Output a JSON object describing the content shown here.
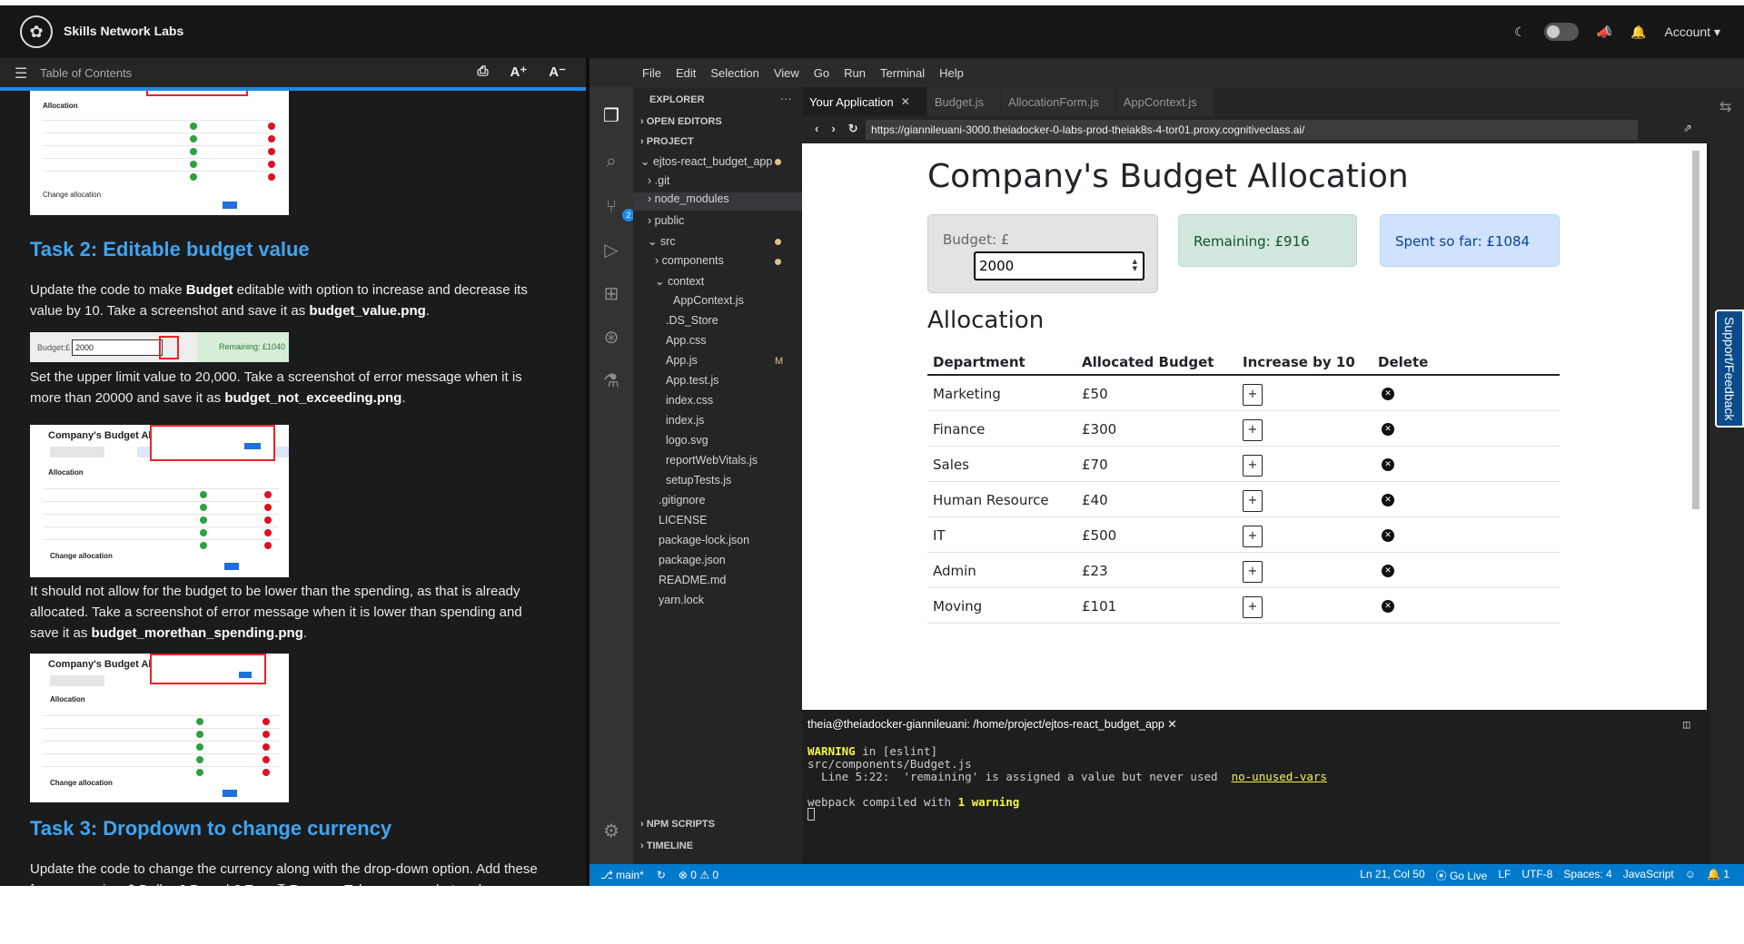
{
  "topbar": {
    "brand": "Skills Network Labs",
    "account": "Account ▾"
  },
  "toc": {
    "label": "Table of Contents",
    "font_up": "A⁺",
    "font_down": "A⁻"
  },
  "left": {
    "task2_title": "Task 2: Editable budget value",
    "task2_p1_a": "Update the code to make ",
    "task2_p1_b": "Budget",
    "task2_p1_c": " editable with option to increase and decrease its value by 10. Take a screenshot and save it as ",
    "task2_p1_d": "budget_value.png",
    "task2_p1_e": ".",
    "strip_budget": "Budget:£",
    "strip_value": "2000",
    "strip_remaining": "Remaining: £1040",
    "task2_p2_a": "Set the upper limit value to 20,000. Take a screenshot of error message when it is more than 20000 and save it as ",
    "task2_p2_b": "budget_not_exceeding.png",
    "task2_p2_c": ".",
    "task2_p3_a": "It should not allow for the budget to be lower than the spending, as that is already allocated. Take a screenshot of error message when it is lower than spending and save it as ",
    "task2_p3_b": "budget_morethan_spending.png",
    "task2_p3_c": ".",
    "thumb_title": "Company's Budget Allo",
    "thumb_alloc": "Allocation",
    "thumb_change": "Change allocation",
    "task3_title": "Task 3: Dropdown to change currency",
    "task3_p1": "Update the code to change the currency along with the drop-down option. Add these four currencies: $ Dollar £ Pound € Euro ₹ Ruppee. Take a screenshot and save"
  },
  "menu": [
    "File",
    "Edit",
    "Selection",
    "View",
    "Go",
    "Run",
    "Terminal",
    "Help"
  ],
  "explorer": {
    "title": "EXPLORER",
    "more": "···",
    "open_editors": "OPEN EDITORS",
    "project": "PROJECT",
    "root": "ejtos-react_budget_app",
    "items": [
      ".git",
      "node_modules",
      "public",
      "src",
      "components",
      "context",
      "AppContext.js",
      ".DS_Store",
      "App.css",
      "App.js",
      "App.test.js",
      "index.css",
      "index.js",
      "logo.svg",
      "reportWebVitals.js",
      "setupTests.js",
      ".gitignore",
      "LICENSE",
      "package-lock.json",
      "package.json",
      "README.md",
      "yarn.lock"
    ],
    "modified_mark": "M",
    "npm_scripts": "NPM SCRIPTS",
    "timeline": "TIMELINE"
  },
  "tabs": [
    "Your Application",
    "Budget.js",
    "AllocationForm.js",
    "AppContext.js"
  ],
  "url": "https://giannileuani-3000.theiadocker-0-labs-prod-theiak8s-4-tor01.proxy.cognitiveclass.ai/",
  "app": {
    "title": "Company's Budget Allocation",
    "budget_label": "Budget: £",
    "budget_value": "2000",
    "remaining": "Remaining: £916",
    "spent": "Spent so far: £1084",
    "allocation_title": "Allocation",
    "headers": [
      "Department",
      "Allocated Budget",
      "Increase by 10",
      "Delete"
    ],
    "rows": [
      {
        "dept": "Marketing",
        "budget": "£50"
      },
      {
        "dept": "Finance",
        "budget": "£300"
      },
      {
        "dept": "Sales",
        "budget": "£70"
      },
      {
        "dept": "Human Resource",
        "budget": "£40"
      },
      {
        "dept": "IT",
        "budget": "£500"
      },
      {
        "dept": "Admin",
        "budget": "£23"
      },
      {
        "dept": "Moving",
        "budget": "£101"
      }
    ],
    "plus": "+",
    "delete": "✕"
  },
  "terminal": {
    "title": "theia@theiadocker-giannileuani: /home/project/ejtos-react_budget_app",
    "l1a": "WARNING",
    "l1b": " in [eslint]",
    "l2": "src/components/Budget.js",
    "l3": "  Line 5:22:  'remaining' is assigned a value but never used  ",
    "l3link": "no-unused-vars",
    "l4a": "webpack compiled with ",
    "l4b": "1 warning"
  },
  "status": {
    "branch": "main*",
    "errors": "⊗ 0 ⚠ 0",
    "pos": "Ln 21, Col 50",
    "golive": "⦿ Go Live",
    "eol": "LF",
    "enc": "UTF-8",
    "spaces": "Spaces: 4",
    "lang": "JavaScript",
    "notif": "1"
  },
  "support": "Support/Feedback",
  "colors": {
    "accent": "#1e88e5",
    "heading": "#3da5f4",
    "statusbar": "#007acc"
  }
}
